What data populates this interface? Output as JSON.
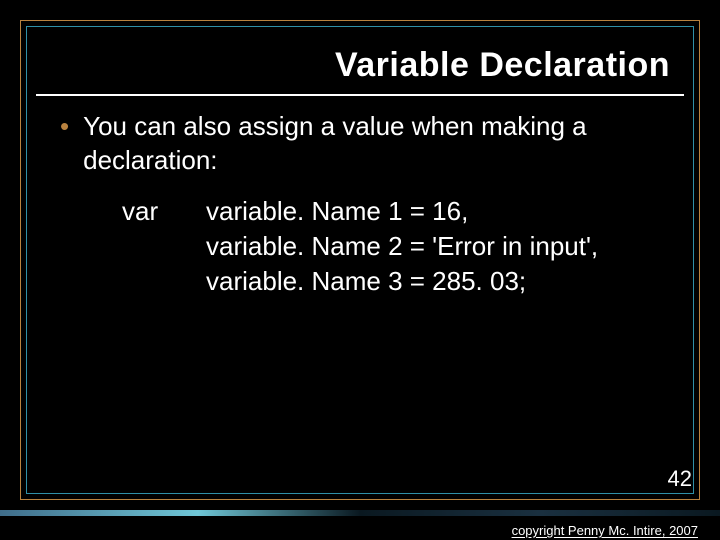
{
  "slide": {
    "title": "Variable Declaration",
    "bullet": {
      "dot": "•",
      "text": "You can also assign a value when making a declaration:"
    },
    "code": {
      "keyword": "var",
      "line1": "variable. Name 1 = 16,",
      "line2": "variable. Name 2 = 'Error in input',",
      "line3": "variable. Name 3 = 285. 03;"
    },
    "number": "42",
    "copyright": "copyright Penny Mc. Intire, 2007"
  }
}
